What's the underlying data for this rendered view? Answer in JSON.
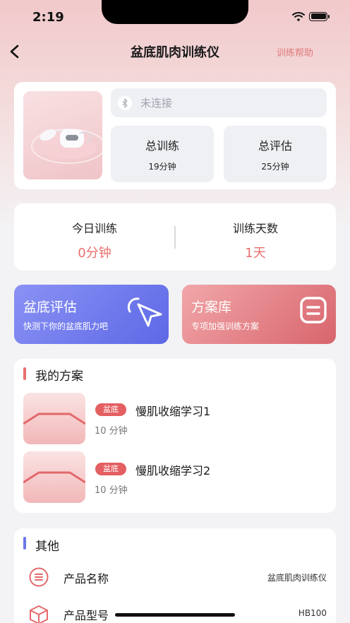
{
  "status_bar": {
    "time": "2:19"
  },
  "nav": {
    "title": "盆底肌肉训练仪",
    "help_label": "训练帮助"
  },
  "device": {
    "connection_status": "未连接",
    "stats": [
      {
        "label": "总训练",
        "value": "19分钟"
      },
      {
        "label": "总评估",
        "value": "25分钟"
      }
    ]
  },
  "today": {
    "items": [
      {
        "label": "今日训练",
        "value": "0分钟"
      },
      {
        "label": "训练天数",
        "value": "1天"
      }
    ]
  },
  "features": {
    "eval": {
      "title": "盆底评估",
      "subtitle": "快测下你的盆底肌力吧"
    },
    "library": {
      "title": "方案库",
      "subtitle": "专项加强训练方案"
    }
  },
  "my_plans": {
    "title": "我的方案",
    "items": [
      {
        "tag": "盆底",
        "name": "慢肌收缩学习1",
        "duration": "10 分钟"
      },
      {
        "tag": "盆底",
        "name": "慢肌收缩学习2",
        "duration": "10 分钟"
      }
    ]
  },
  "other": {
    "title": "其他",
    "rows": [
      {
        "label": "产品名称",
        "value": "盆底肌肉训练仪"
      },
      {
        "label": "产品型号",
        "value": "HB100"
      }
    ]
  },
  "colors": {
    "accent_red": "#e8706e",
    "eval_blue": "#6d78e8",
    "library_pink": "#d8646d"
  },
  "icons": [
    "back-arrow-icon",
    "wifi-icon",
    "battery-icon",
    "bluetooth-icon",
    "cursor-click-icon",
    "list-box-icon",
    "list-circle-icon",
    "package-box-icon"
  ]
}
